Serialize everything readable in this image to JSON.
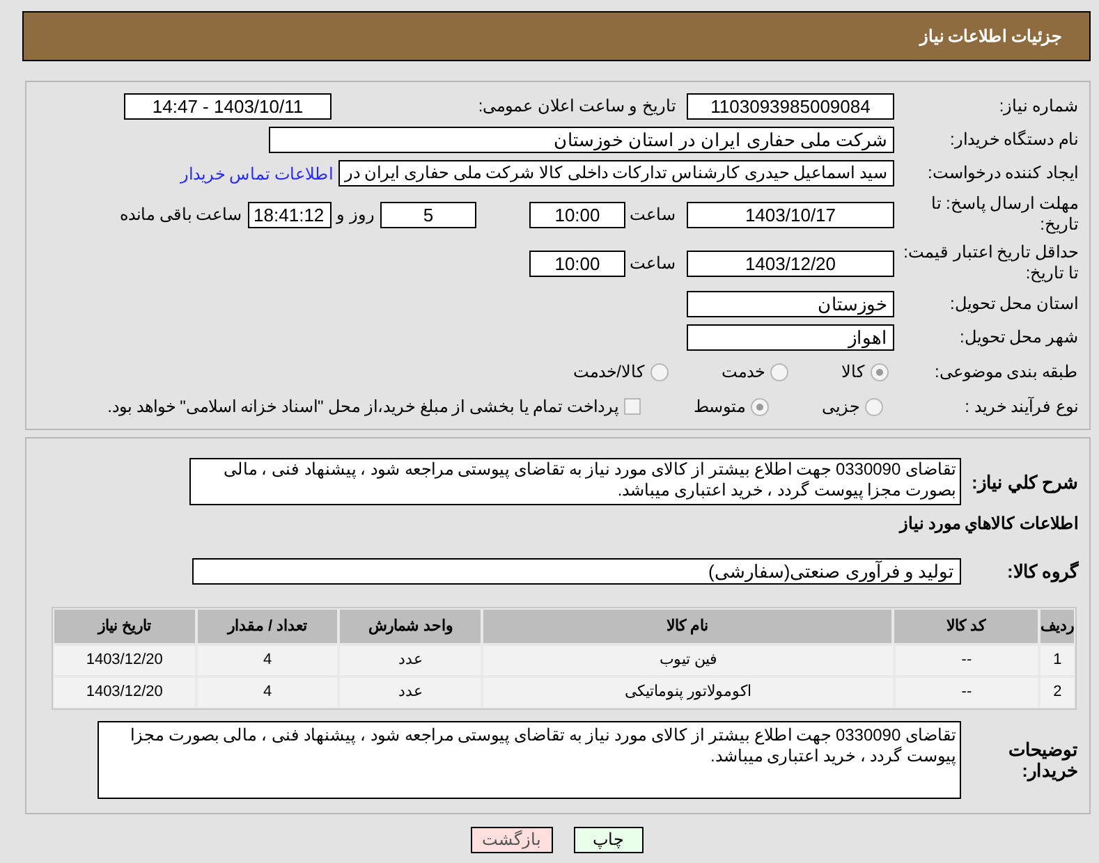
{
  "header": {
    "title": "جزئیات اطلاعات نیاز"
  },
  "need_number": {
    "label": "شماره نیاز:",
    "value": "1103093985009084"
  },
  "announce": {
    "label": "تاریخ و ساعت اعلان عمومی:",
    "value": "1403/10/11 - 14:47"
  },
  "buyer_org": {
    "label": "نام دستگاه خریدار:",
    "value": "شرکت ملی حفاری ایران در استان خوزستان"
  },
  "creator": {
    "label": "ایجاد کننده درخواست:",
    "value": "سید اسماعیل حیدری کارشناس تدارکات داخلی کالا شرکت ملی حفاری ایران در",
    "link": "اطلاعات تماس خریدار"
  },
  "deadline": {
    "label": "مهلت ارسال پاسخ: تا تاریخ:",
    "date": "1403/10/17",
    "time_label": "ساعت",
    "time": "10:00",
    "days": "5",
    "days_label": "روز و",
    "remaining": "18:41:12",
    "remaining_label": "ساعت باقی مانده"
  },
  "price_validity": {
    "label": "حداقل تاریخ اعتبار قیمت: تا تاریخ:",
    "date": "1403/12/20",
    "time_label": "ساعت",
    "time": "10:00"
  },
  "province": {
    "label": "استان محل تحویل:",
    "value": "خوزستان"
  },
  "city": {
    "label": "شهر محل تحویل:",
    "value": "اهواز"
  },
  "category": {
    "label": "طبقه بندی موضوعی:",
    "options": [
      {
        "label": "کالا",
        "selected": true
      },
      {
        "label": "خدمت",
        "selected": false
      },
      {
        "label": "کالا/خدمت",
        "selected": false
      }
    ]
  },
  "process": {
    "label": "نوع فرآیند خرید :",
    "options": [
      {
        "label": "جزیی",
        "selected": false
      },
      {
        "label": "متوسط",
        "selected": true
      }
    ],
    "payment_checked": false,
    "payment_note": "پرداخت تمام یا بخشی از مبلغ خرید،از محل \"اسناد خزانه اسلامی\" خواهد بود."
  },
  "description": {
    "label": "شرح کلي نياز:",
    "value": "تقاضای 0330090 جهت اطلاع بیشتر از کالای مورد نیاز به تقاضای پیوستی مراجعه شود ، پیشنهاد فنی ، مالی بصورت مجزا پیوست گردد ، خرید اعتباری میباشد."
  },
  "goods_heading": "اطلاعات کالاهاي مورد نياز",
  "goods_group": {
    "label": "گروه کالا:",
    "value": "تولید و فرآوری صنعتی(سفارشی)"
  },
  "table": {
    "columns": [
      "ردیف",
      "کد کالا",
      "نام کالا",
      "واحد شمارش",
      "تعداد / مقدار",
      "تاریخ نیاز"
    ],
    "rows": [
      [
        "1",
        "--",
        "فین تیوب",
        "عدد",
        "4",
        "1403/12/20"
      ],
      [
        "2",
        "--",
        "اکومولاتور پنوماتیکی",
        "عدد",
        "4",
        "1403/12/20"
      ]
    ]
  },
  "buyer_notes": {
    "label": "توضیحات خریدار:",
    "value": "تقاضای 0330090 جهت اطلاع بیشتر از کالای مورد نیاز به تقاضای پیوستی مراجعه شود ، پیشنهاد فنی ، مالی بصورت مجزا پیوست گردد ، خرید اعتباری میباشد."
  },
  "buttons": {
    "back": "بازگشت",
    "print": "چاپ"
  }
}
